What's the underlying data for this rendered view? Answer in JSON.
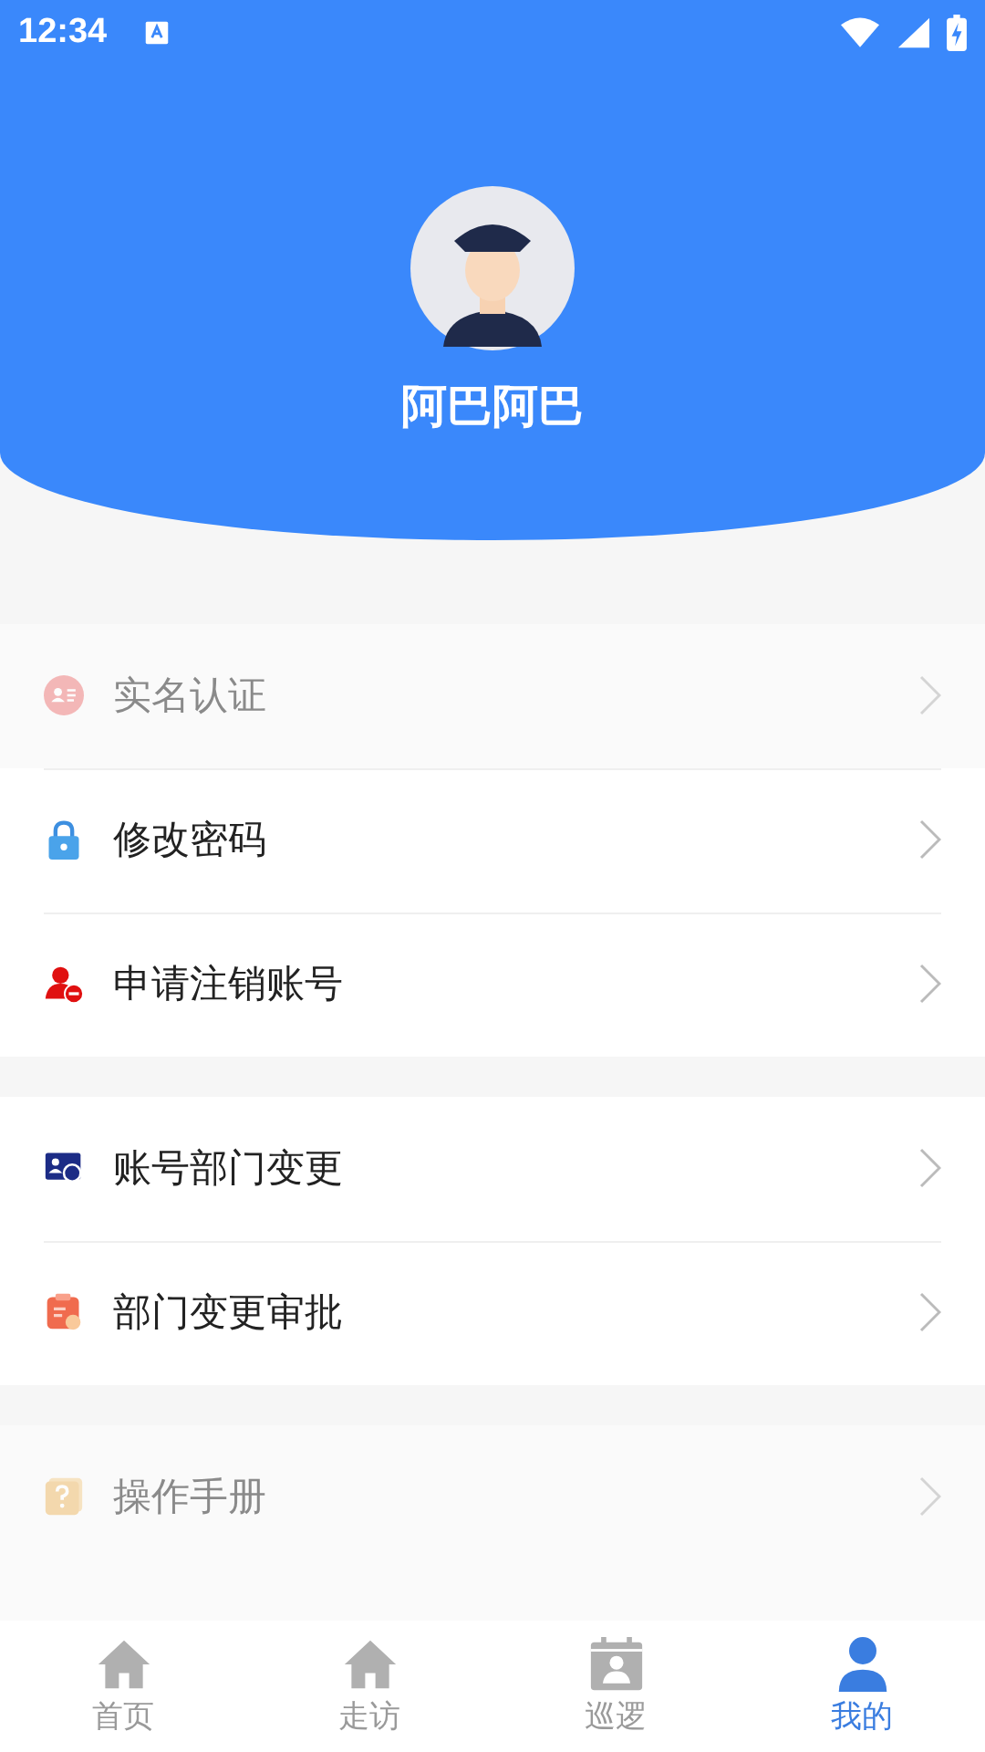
{
  "status_bar": {
    "time": "12:34"
  },
  "profile": {
    "name": "阿巴阿巴"
  },
  "sections": [
    {
      "items": [
        {
          "label": "实名认证",
          "kind": "id-card",
          "disabled": true
        },
        {
          "label": "修改密码",
          "kind": "lock",
          "disabled": false
        },
        {
          "label": "申请注销账号",
          "kind": "user-remove",
          "disabled": false
        }
      ]
    },
    {
      "items": [
        {
          "label": "账号部门变更",
          "kind": "card-swap",
          "disabled": false
        },
        {
          "label": "部门变更审批",
          "kind": "clipboard",
          "disabled": false
        }
      ]
    },
    {
      "items": [
        {
          "label": "操作手册",
          "kind": "question",
          "disabled": true
        }
      ]
    }
  ],
  "bottom_nav": [
    {
      "label": "首页",
      "kind": "house",
      "selected": false
    },
    {
      "label": "走访",
      "kind": "house",
      "selected": false
    },
    {
      "label": "巡逻",
      "kind": "calendar",
      "selected": false
    },
    {
      "label": "我的",
      "kind": "person",
      "selected": true
    }
  ]
}
